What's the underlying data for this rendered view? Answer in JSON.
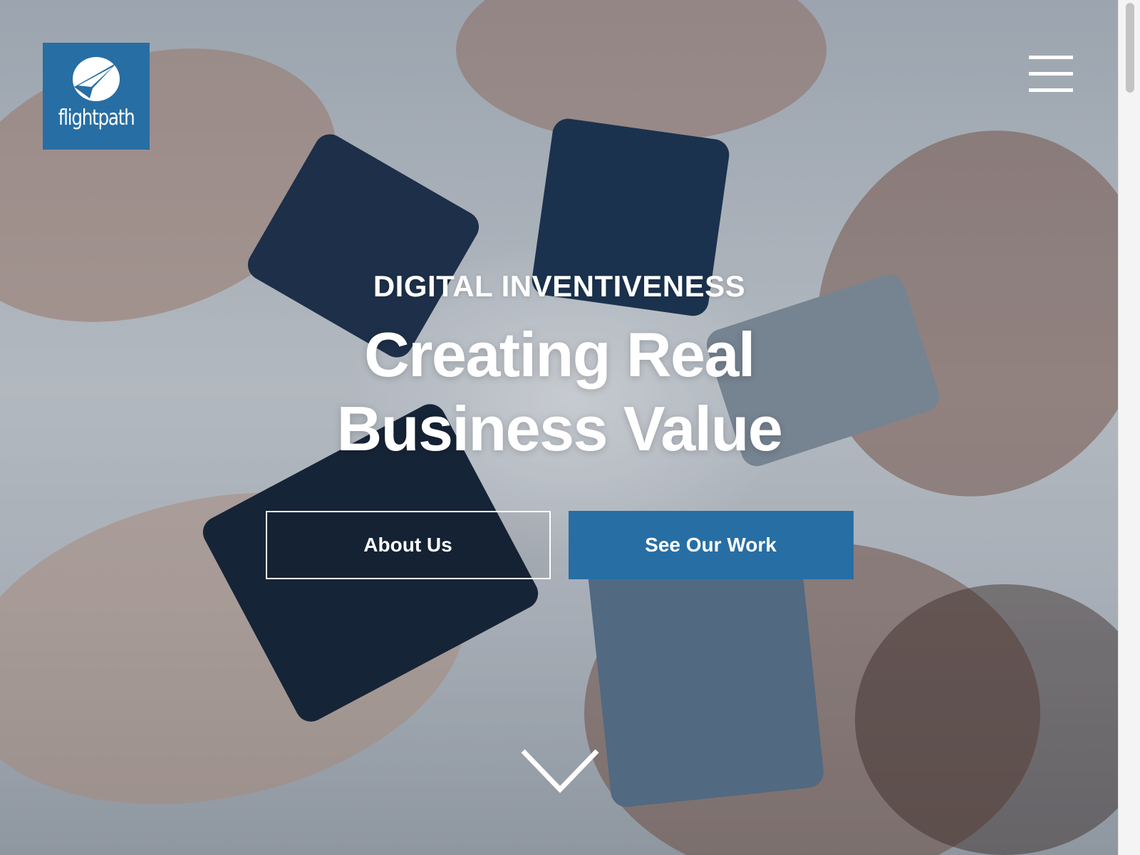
{
  "brand": {
    "name": "flightpath",
    "color": "#276ea4"
  },
  "header": {
    "menu_icon": "hamburger-menu-icon"
  },
  "hero": {
    "eyebrow": "DIGITAL INVENTIVENESS",
    "headline_line1": "Creating Real",
    "headline_line2": "Business Value",
    "buttons": {
      "about": "About Us",
      "work": "See Our Work"
    },
    "scroll_icon": "chevron-down-icon",
    "background": "photo of hands holding smartphones in a circle"
  }
}
